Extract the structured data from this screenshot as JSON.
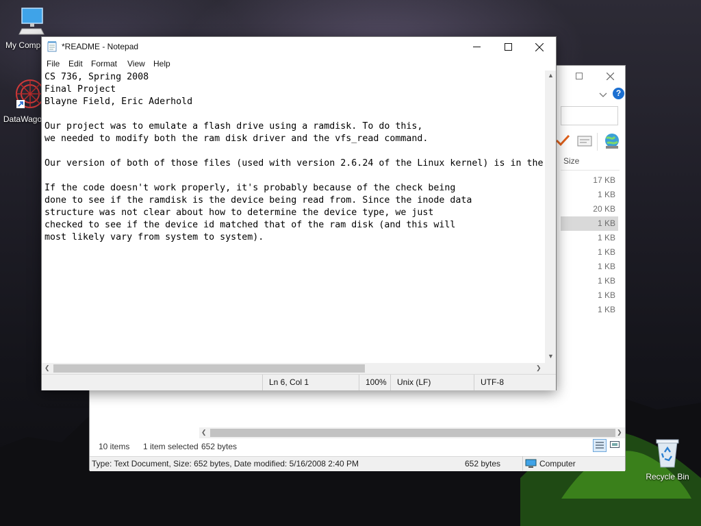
{
  "desktop": {
    "icons": [
      {
        "label": "My Compu",
        "icon": "computer-icon"
      },
      {
        "label": "DataWago",
        "icon": "datawagon-icon"
      },
      {
        "label": "Recycle Bin",
        "icon": "recycle-bin-icon"
      }
    ]
  },
  "notepad": {
    "title": "*README - Notepad",
    "menu": [
      "File",
      "Edit",
      "Format",
      "View",
      "Help"
    ],
    "lines": [
      "CS 736, Spring 2008",
      "Final Project",
      "Blayne Field, Eric Aderhold",
      "",
      "Our project was to emulate a flash drive using a ramdisk. To do this,",
      "we needed to modify both the ram disk driver and the vfs_read command.",
      "",
      "Our version of both of those files (used with version 2.6.24 of the Linux kernel) is in the",
      "",
      "If the code doesn't work properly, it's probably because of the check being",
      "done to see if the ramdisk is the device being read from. Since the inode data",
      "structure was not clear about how to determine the device type, we just",
      "checked to see if the device id matched that of the ram disk (and this will",
      "most likely vary from system to system)."
    ],
    "status": {
      "position": "Ln 6, Col 1",
      "zoom": "100%",
      "line_ending": "Unix (LF)",
      "encoding": "UTF-8"
    }
  },
  "explorer": {
    "column_header": "Size",
    "sizes": [
      "17 KB",
      "1 KB",
      "20 KB",
      "1 KB",
      "1 KB",
      "1 KB",
      "1 KB",
      "1 KB",
      "1 KB",
      "1 KB"
    ],
    "selected_index": 3,
    "status": {
      "items": "10 items",
      "selected": "1 item selected",
      "selected_size": "652 bytes"
    },
    "details_bar": {
      "info": "Type: Text Document, Size: 652 bytes, Date modified: 5/16/2008 2:40 PM",
      "size": "652 bytes",
      "location": "Computer"
    }
  }
}
